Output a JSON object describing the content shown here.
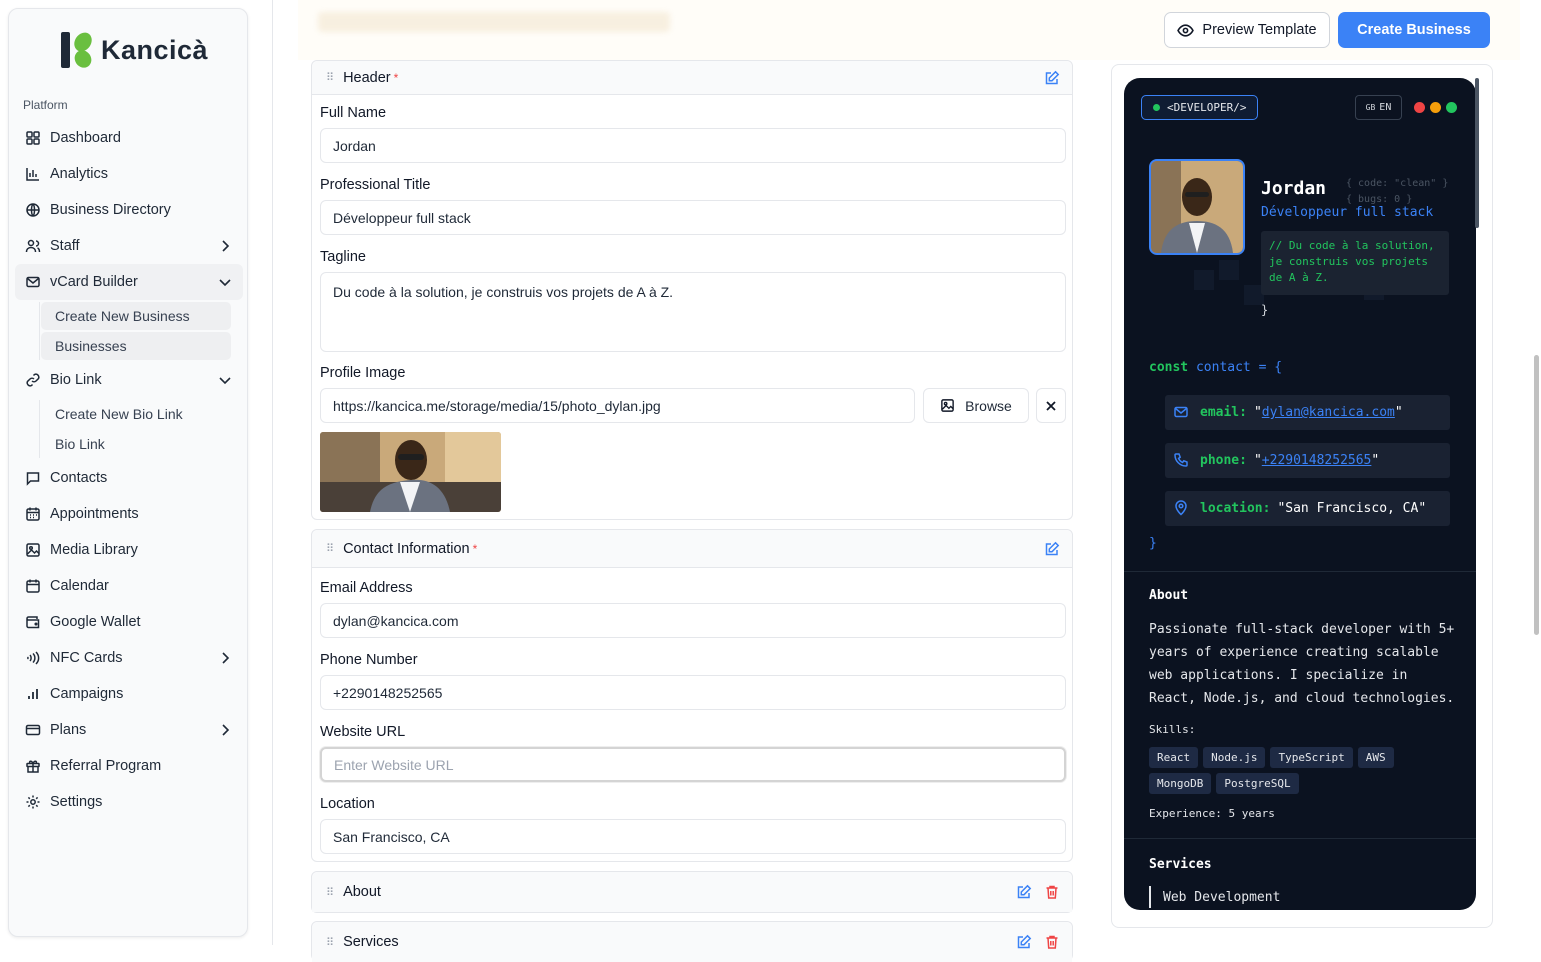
{
  "app": {
    "logo_text": "Kancicà"
  },
  "sidebar": {
    "section_label": "Platform",
    "items": [
      {
        "label": "Dashboard"
      },
      {
        "label": "Analytics"
      },
      {
        "label": "Business Directory"
      },
      {
        "label": "Staff"
      },
      {
        "label": "vCard Builder"
      },
      {
        "label": "Bio Link"
      },
      {
        "label": "Contacts"
      },
      {
        "label": "Appointments"
      },
      {
        "label": "Media Library"
      },
      {
        "label": "Calendar"
      },
      {
        "label": "Google Wallet"
      },
      {
        "label": "NFC Cards"
      },
      {
        "label": "Campaigns"
      },
      {
        "label": "Plans"
      },
      {
        "label": "Referral Program"
      },
      {
        "label": "Settings"
      }
    ],
    "vcard_sub": [
      {
        "label": "Create New Business"
      },
      {
        "label": "Businesses"
      }
    ],
    "biolink_sub": [
      {
        "label": "Create New Bio Link"
      },
      {
        "label": "Bio Link"
      }
    ]
  },
  "toolbar": {
    "preview_label": "Preview Template",
    "create_label": "Create Business"
  },
  "form": {
    "header_section": {
      "title": "Header",
      "required_mark": "*",
      "full_name_label": "Full Name",
      "full_name_value": "Jordan",
      "title_label": "Professional Title",
      "title_value": "Développeur full stack",
      "tagline_label": "Tagline",
      "tagline_value": "Du code à la solution, je construis vos projets de A à Z.",
      "image_label": "Profile Image",
      "image_value": "https://kancica.me/storage/media/15/photo_dylan.jpg",
      "browse_label": "Browse"
    },
    "contact_section": {
      "title": "Contact Information",
      "required_mark": "*",
      "email_label": "Email Address",
      "email_value": "dylan@kancica.com",
      "phone_label": "Phone Number",
      "phone_value": "+2290148252565",
      "website_label": "Website URL",
      "website_placeholder": "Enter Website URL",
      "location_label": "Location",
      "location_value": "San Francisco, CA"
    },
    "about_section": {
      "title": "About"
    },
    "services_section": {
      "title": "Services"
    }
  },
  "preview": {
    "badge": "<DEVELOPER/>",
    "lang_flag": "GB",
    "lang": "EN",
    "name": "Jordan",
    "title": "Développeur full stack",
    "code_hint_1": "{ code: \"clean\" }",
    "code_hint_2": "{ bugs: 0 }",
    "tagline": "// Du code à la solution, je construis vos projets de A à Z.",
    "close_brace": "}",
    "const_kw": "const",
    "const_name": "contact",
    "const_eq": "= {",
    "email_key": "email:",
    "email_val": "dylan@kancica.com",
    "phone_key": "phone:",
    "phone_val": "+2290148252565",
    "location_key": "location:",
    "location_val": "\"San Francisco, CA\"",
    "end_brace": "}",
    "about_title": "About",
    "about_text": "Passionate full-stack developer with 5+ years of experience creating scalable web applications. I specialize in React, Node.js, and cloud technologies.",
    "skills_label": "Skills:",
    "skills": [
      "React",
      "Node.js",
      "TypeScript",
      "AWS",
      "MongoDB",
      "PostgreSQL"
    ],
    "experience": "Experience: 5 years",
    "services_title": "Services",
    "service_1": "Web Development"
  },
  "colors": {
    "accent": "#3b82f6",
    "code_green": "#22c55e",
    "dark_bg": "#0b1220",
    "danger": "#ef4444"
  }
}
